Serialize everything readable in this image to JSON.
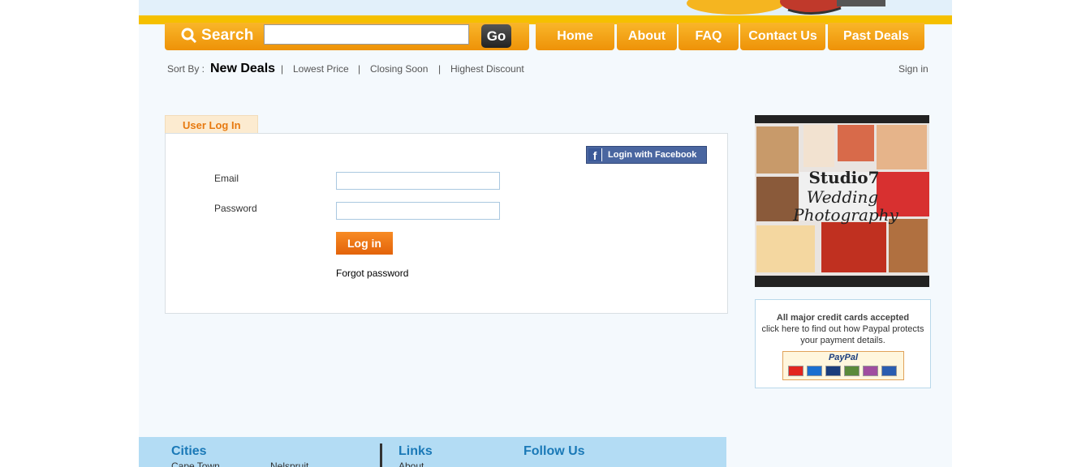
{
  "header": {
    "search_label": "Search",
    "search_placeholder": "",
    "go_label": "Go"
  },
  "nav": {
    "items": [
      "Home",
      "About",
      "FAQ",
      "Contact Us",
      "Past Deals"
    ]
  },
  "sort": {
    "prefix": "Sort By :",
    "active": "New Deals",
    "options": [
      "Lowest Price",
      "Closing Soon",
      "Highest Discount"
    ],
    "separator": "|"
  },
  "account": {
    "signin": "Sign in"
  },
  "login": {
    "tab_label": "User Log In",
    "facebook_button": "Login with Facebook",
    "facebook_glyph": "f",
    "email_label": "Email",
    "email_value": "",
    "password_label": "Password",
    "password_value": "",
    "submit_label": "Log in",
    "forgot_label": "Forgot password"
  },
  "ad": {
    "logo_text": "Studio7",
    "headline1": "Wedding",
    "headline2": "Photography"
  },
  "paypal": {
    "title": "All major credit cards accepted",
    "line1": "click here to find out how Paypal protects",
    "line2": "your payment details.",
    "logo": "PayPal",
    "card_colors": [
      "#e2251f",
      "#1b6fd0",
      "#1a3d7c",
      "#5a8a3a",
      "#a04ea0",
      "#2a5db0"
    ]
  },
  "footer": {
    "cities_heading": "Cities",
    "cities": [
      "Cape Town",
      "Nelspruit"
    ],
    "links_heading": "Links",
    "links": [
      "About"
    ],
    "follow_heading": "Follow Us"
  },
  "colors": {
    "accent_orange": "#f39c12",
    "footer_bg": "#b3dcf4",
    "heading_blue": "#1a79b7"
  }
}
